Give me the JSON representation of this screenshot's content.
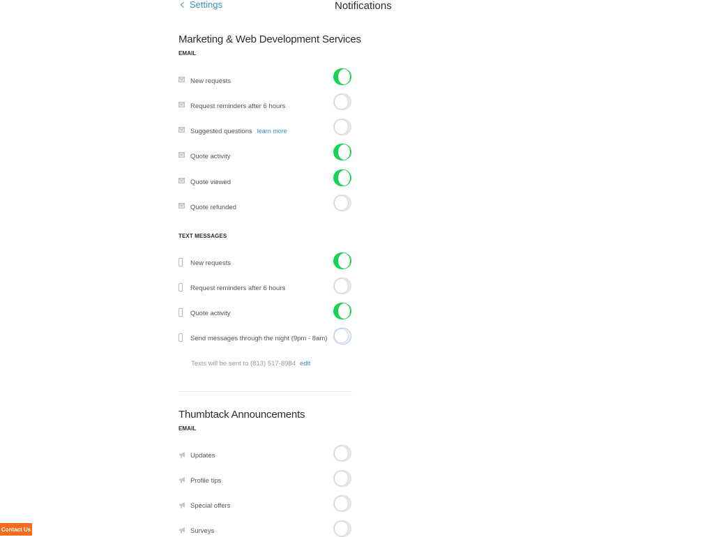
{
  "header": {
    "back_label": "Settings",
    "title": "Notifications"
  },
  "section1": {
    "title": "Marketing & Web Development Services",
    "email_heading": "EMAIL",
    "email_items": [
      {
        "label": "New requests",
        "on": true
      },
      {
        "label": "Request reminders after 6 hours",
        "on": false
      },
      {
        "label": "Suggested questions",
        "link": "learn more",
        "on": false
      },
      {
        "label": "Quote activity",
        "on": true
      },
      {
        "label": "Quote viewed",
        "on": true
      },
      {
        "label": "Quote refunded",
        "on": false
      }
    ],
    "text_heading": "TEXT MESSAGES",
    "text_items": [
      {
        "label": "New requests",
        "on": true
      },
      {
        "label": "Request reminders after 6 hours",
        "on": false
      },
      {
        "label": "Quote activity",
        "on": true
      },
      {
        "label": "Send messages through the night (9pm - 8am)",
        "on": false
      }
    ],
    "phone_note": "Texts will be sent to (813) 517-8984",
    "phone_edit": "edit"
  },
  "section2": {
    "title": "Thumbtack Announcements",
    "email_heading": "EMAIL",
    "items": [
      {
        "label": "Updates",
        "on": false
      },
      {
        "label": "Profile tips",
        "on": false
      },
      {
        "label": "Special offers",
        "on": false
      },
      {
        "label": "Surveys",
        "on": false
      }
    ]
  },
  "contact_label": "Contact Us",
  "colors": {
    "toggle_on": "#17d456",
    "link": "#3b8bd6",
    "contact": "#f26c1b"
  },
  "icons": {
    "email": "envelope-icon",
    "text": "phone-icon",
    "announcement": "megaphone-icon"
  }
}
